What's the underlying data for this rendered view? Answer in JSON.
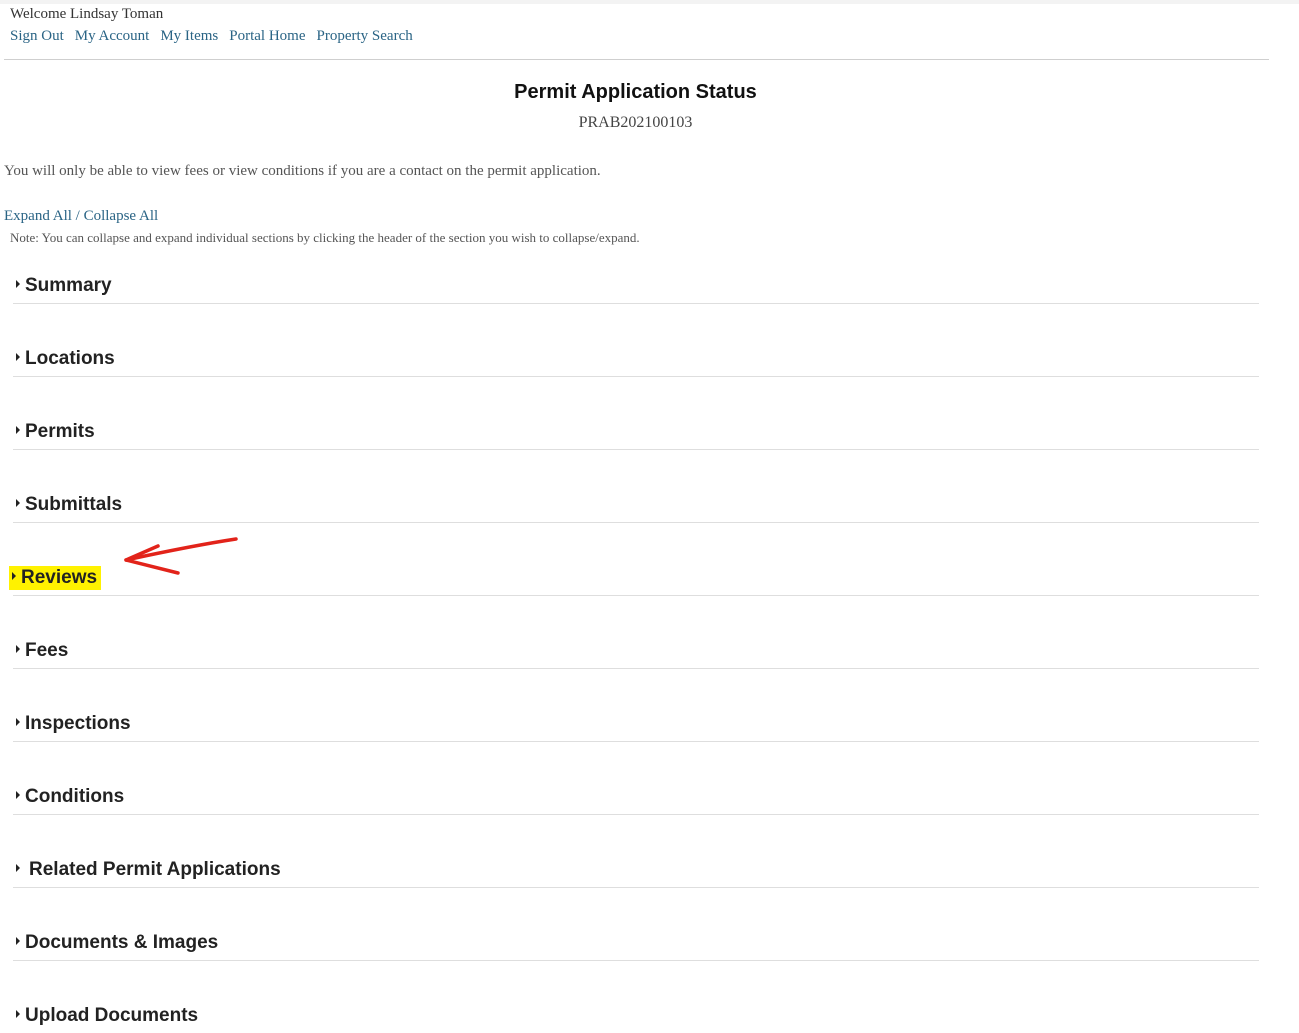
{
  "header": {
    "welcome": "Welcome Lindsay Toman",
    "nav": [
      "Sign Out",
      "My Account",
      "My Items",
      "Portal Home",
      "Property Search"
    ]
  },
  "page": {
    "title": "Permit Application Status",
    "permit_number": "PRAB202100103",
    "notice": "You will only be able to view fees or view conditions if you are a contact on the permit application.",
    "expand_all": "Expand All",
    "separator": " / ",
    "collapse_all": "Collapse All",
    "note": "Note: You can collapse and expand individual sections by clicking the header of the section you wish to collapse/expand."
  },
  "sections": [
    "Summary",
    "Locations",
    "Permits",
    "Submittals",
    "Reviews",
    "Fees",
    "Inspections",
    "Conditions",
    "Related Permit Applications",
    "Documents & Images",
    "Upload Documents"
  ],
  "colors": {
    "link": "#2a6485",
    "highlight": "#fff200",
    "annotation_arrow": "#e2231a"
  },
  "annotation": {
    "highlighted_section": "Reviews",
    "arrow_icon": "red-arrow-icon"
  }
}
